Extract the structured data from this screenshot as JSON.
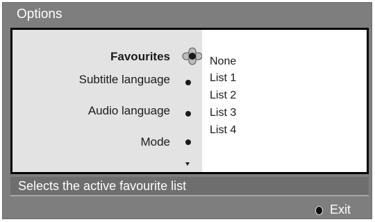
{
  "window": {
    "title": "Options"
  },
  "menu": {
    "items": [
      {
        "label": "Favourites"
      },
      {
        "label": "Subtitle language"
      },
      {
        "label": "Audio language"
      },
      {
        "label": "Mode"
      }
    ]
  },
  "submenu": {
    "options": [
      "None",
      "List 1",
      "List 2",
      "List 3",
      "List 4"
    ]
  },
  "status": {
    "text": "Selects the active favourite list"
  },
  "footer": {
    "exit_label": "Exit",
    "exit_icon": "ok-button-icon"
  },
  "colors": {
    "window_bg": "#7e7e7e",
    "panel_border": "#000000",
    "menu_bg": "#e3e3e3",
    "submenu_bg": "#ffffff",
    "status_bg": "#6e6e6e"
  }
}
